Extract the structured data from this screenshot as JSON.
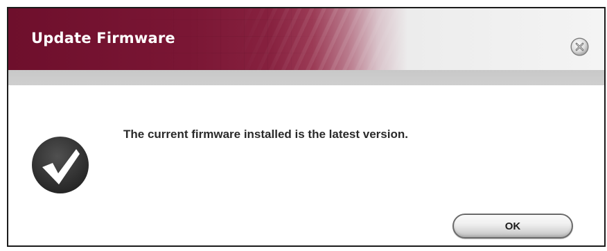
{
  "dialog": {
    "title": "Update Firmware",
    "message": "The current firmware installed is the latest version.",
    "ok_label": "OK",
    "close_icon": "close-icon",
    "status_icon": "checkmark-icon"
  },
  "colors": {
    "titlebar_dark": "#6e0f2c",
    "titlebar_light": "#f4f4f4",
    "subbar": "#c8c8c8",
    "message_text": "#2a2a2a",
    "icon_dark": "#2e2e2e"
  }
}
